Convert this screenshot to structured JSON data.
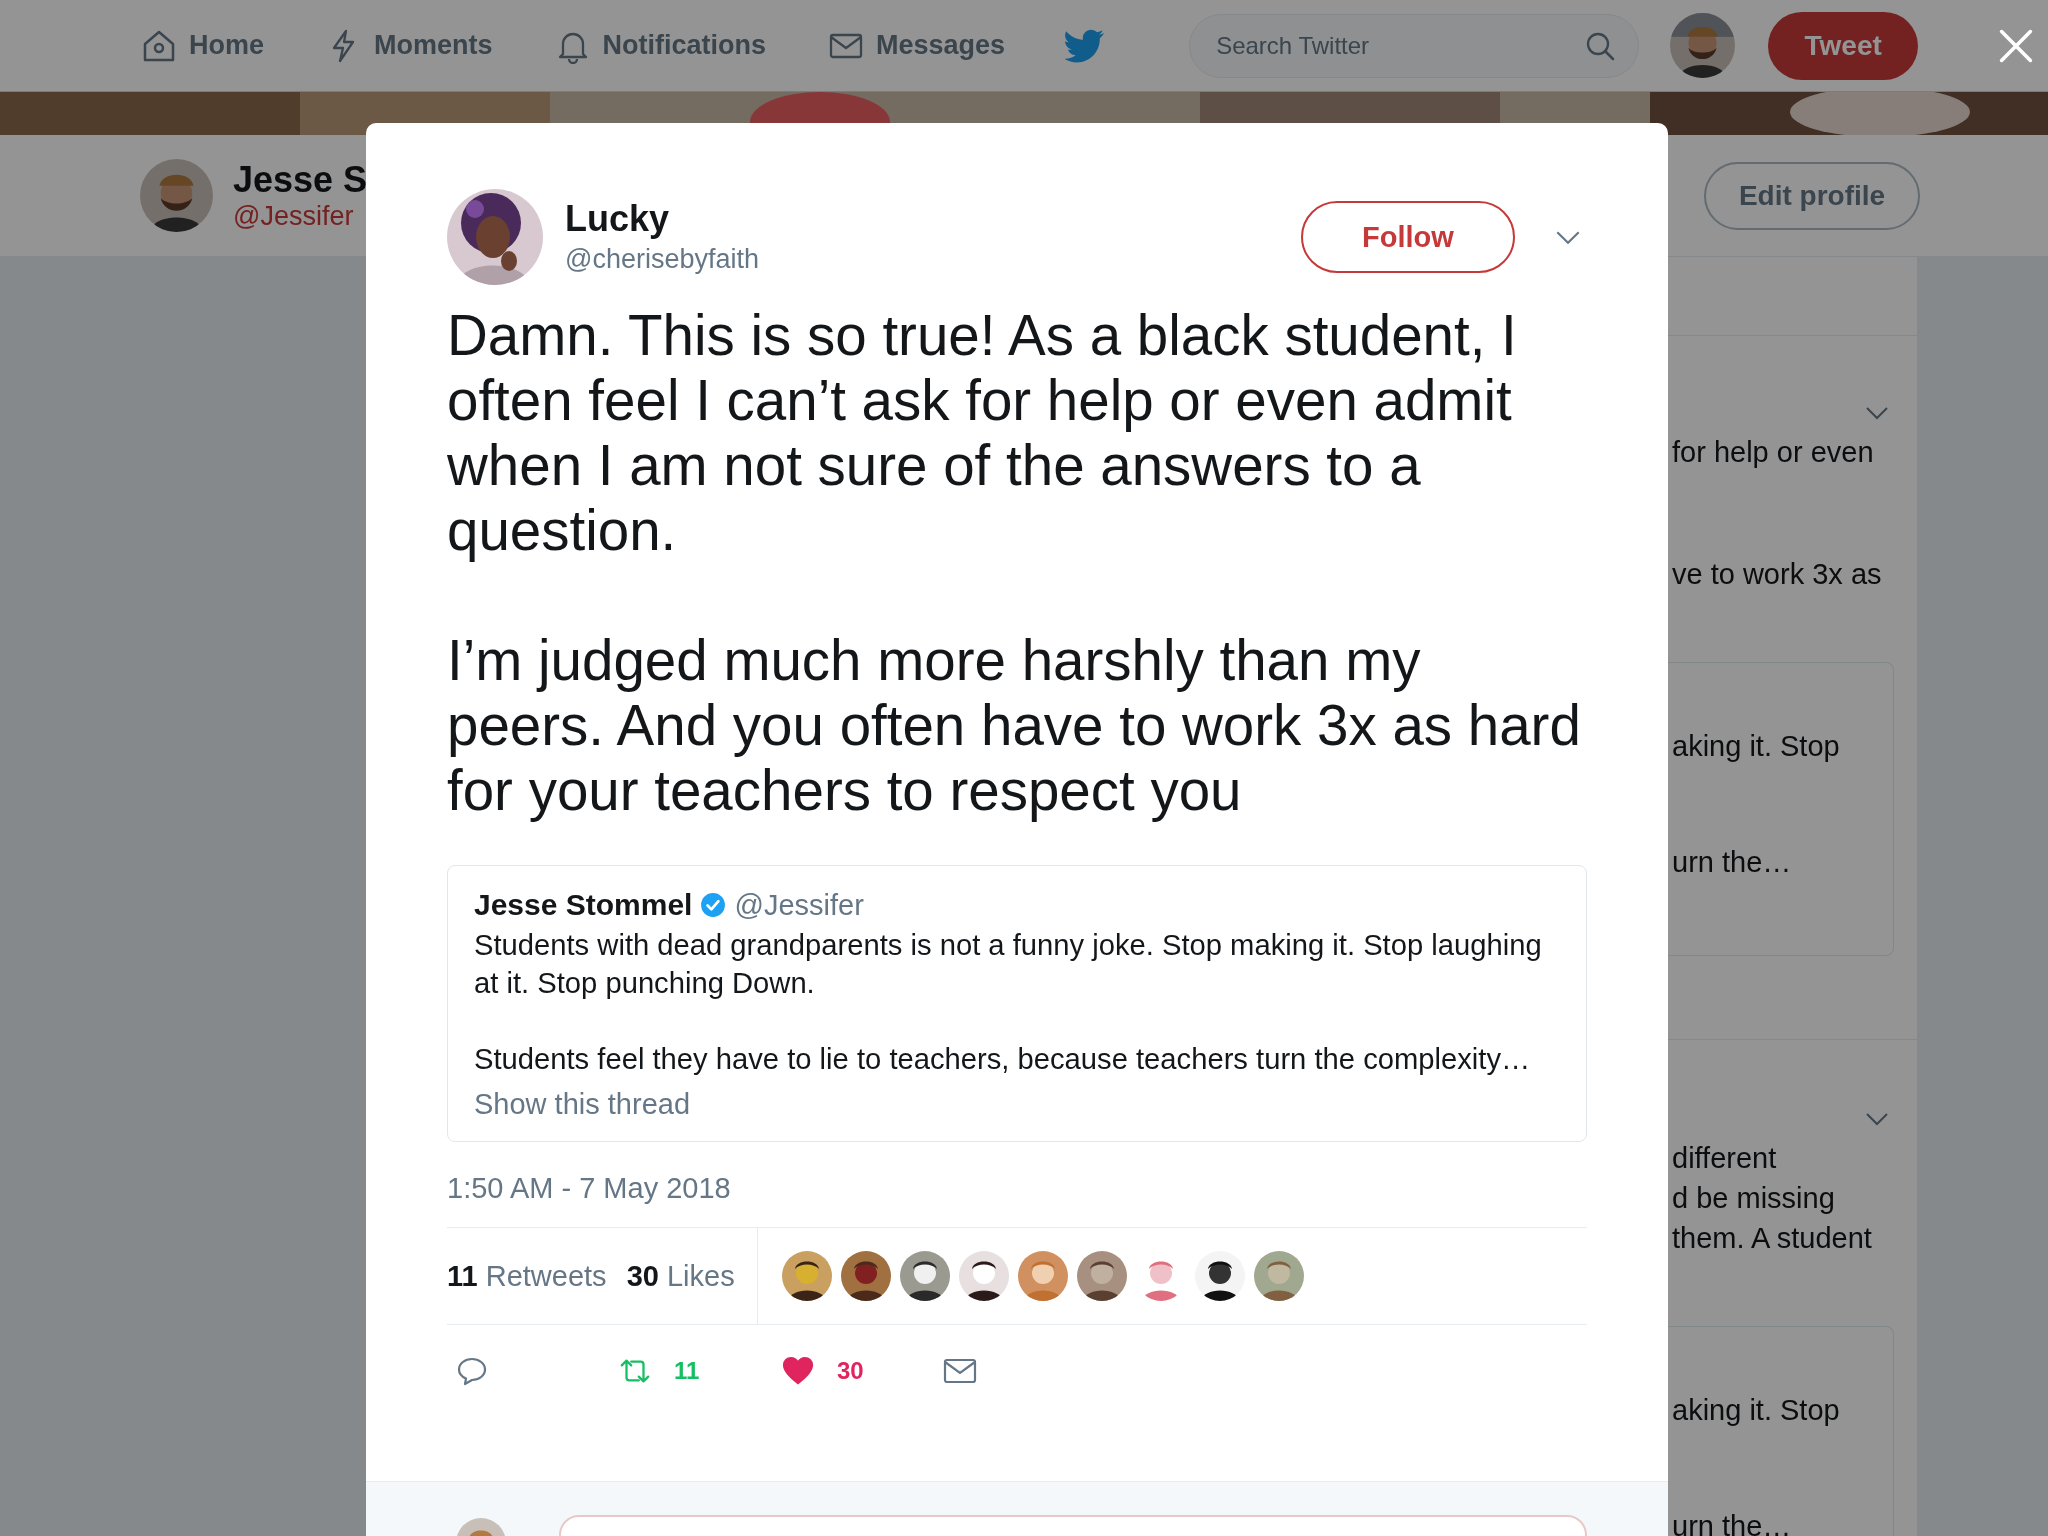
{
  "nav": {
    "items": [
      {
        "kind": "home",
        "label": "Home",
        "selected": false
      },
      {
        "kind": "moments",
        "label": "Moments",
        "selected": false
      },
      {
        "kind": "notifications",
        "label": "Notifications",
        "selected": false
      },
      {
        "kind": "messages",
        "label": "Messages",
        "selected": false
      }
    ],
    "search": {
      "placeholder": "Search Twitter"
    },
    "tweet_button": "Tweet"
  },
  "profile": {
    "name": "Jesse S",
    "handle": "@Jessifer",
    "edit_button": "Edit profile"
  },
  "timeline": [
    {
      "lines": [
        "for help or even",
        "ve to work 3x as"
      ],
      "quote_lines": [
        "aking it. Stop",
        "urn the…"
      ]
    },
    {
      "lines": [
        "different",
        "d be missing",
        "them. A student"
      ],
      "quote_lines": [
        "aking it. Stop",
        "urn the…"
      ]
    }
  ],
  "modal": {
    "author": {
      "name": "Lucky",
      "handle": "@cherisebyfaith"
    },
    "follow_button": "Follow",
    "text": [
      "Damn. This is so true! As a black student, I often feel I can’t ask for help or even admit when I am not sure of the answers to a question.",
      "I’m judged much more harshly than my peers. And you often have to work 3x as hard for your teachers to respect you"
    ],
    "quote": {
      "name": "Jesse Stommel",
      "verified": true,
      "handle": "@Jessifer",
      "text": [
        "Students with dead grandparents is not a funny joke. Stop making it. Stop laughing at it. Stop punching Down.",
        "Students feel they have to lie to teachers, because teachers turn the complexity…"
      ],
      "show_thread": "Show this thread"
    },
    "timestamp": "1:50 AM - 7 May 2018",
    "stats": [
      {
        "count": "11",
        "label": "Retweets"
      },
      {
        "count": "30",
        "label": "Likes"
      }
    ],
    "likers": [
      {
        "kind": "picture"
      },
      {
        "kind": "picture"
      },
      {
        "kind": "picture"
      },
      {
        "kind": "picture"
      },
      {
        "kind": "picture"
      },
      {
        "kind": "picture"
      },
      {
        "kind": "picture"
      },
      {
        "kind": "picture"
      },
      {
        "kind": "picture"
      }
    ],
    "actions": [
      {
        "kind": "reply"
      },
      {
        "kind": "retweet",
        "count": "11"
      },
      {
        "kind": "like",
        "count": "30",
        "liked": true
      },
      {
        "kind": "message"
      }
    ]
  }
}
